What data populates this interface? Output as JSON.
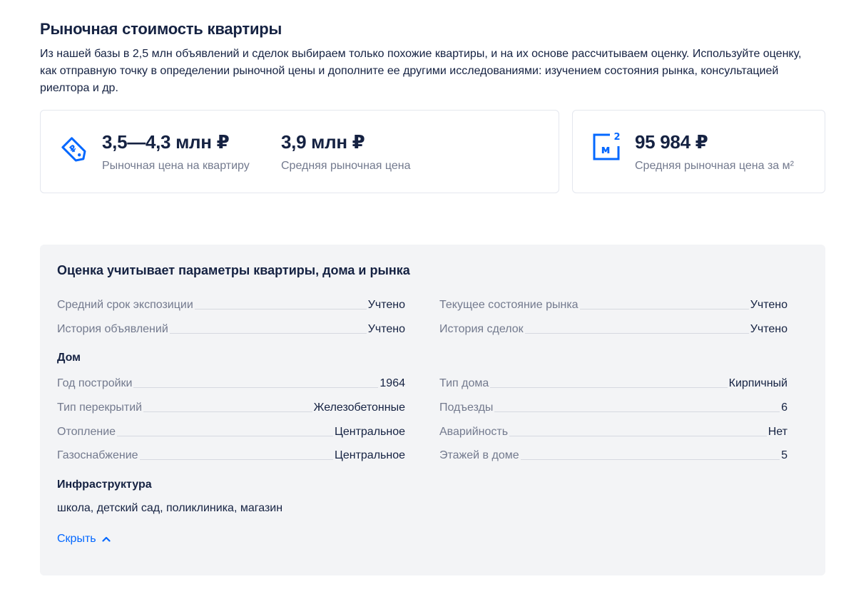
{
  "header": {
    "title": "Рыночная стоимость квартиры",
    "description": "Из нашей базы в 2,5 млн объявлений и сделок выбираем только похожие квартиры, и на их основе рассчитываем оценку. Используйте оценку, как отправную точку в определении рыночной цены и дополните ее другими исследованиями: изучением состояния рынка, консультацией риелтора и др."
  },
  "price_card": {
    "icon": "price-tag-icon",
    "range_value": "3,5—4,3 млн ₽",
    "range_label": "Рыночная цена на квартиру",
    "avg_value": "3,9 млн ₽",
    "avg_label": "Средняя рыночная цена"
  },
  "sqm_card": {
    "icon": "square-meter-icon",
    "icon_text": "м",
    "icon_sup": "2",
    "value": "95 984 ₽",
    "label": "Средняя рыночная цена за м²"
  },
  "params": {
    "title": "Оценка учитывает параметры квартиры, дома и рынка",
    "market": [
      {
        "label": "Средний срок экспозиции",
        "value": "Учтено"
      },
      {
        "label": "Текущее состояние рынка",
        "value": "Учтено"
      },
      {
        "label": "История объявлений",
        "value": "Учтено"
      },
      {
        "label": "История сделок",
        "value": "Учтено"
      }
    ],
    "house_heading": "Дом",
    "house": [
      {
        "label": "Год постройки",
        "value": "1964"
      },
      {
        "label": "Тип дома",
        "value": "Кирпичный"
      },
      {
        "label": "Тип перекрытий",
        "value": "Железобетонные"
      },
      {
        "label": "Подъезды",
        "value": "6"
      },
      {
        "label": "Отопление",
        "value": "Центральное"
      },
      {
        "label": "Аварийность",
        "value": "Нет"
      },
      {
        "label": "Газоснабжение",
        "value": "Центральное"
      },
      {
        "label": "Этажей в доме",
        "value": "5"
      }
    ],
    "infra_heading": "Инфраструктура",
    "infra_text": "школа, детский сад, поликлиника, магазин",
    "hide_label": "Скрыть"
  },
  "colors": {
    "accent": "#0468ff",
    "text": "#152242",
    "muted": "#737a8e",
    "panel_bg": "#f3f4f6"
  }
}
